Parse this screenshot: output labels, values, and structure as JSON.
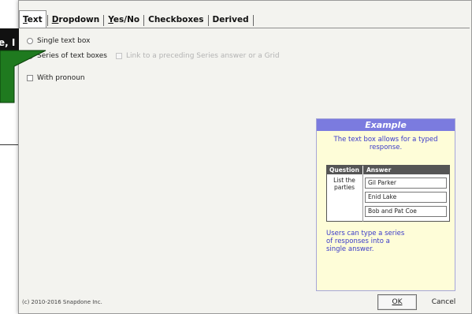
{
  "callout": {
    "text": "e, I"
  },
  "tabs": [
    {
      "label": "Text",
      "mnemonic": "T",
      "rest": "ext",
      "active": true
    },
    {
      "label": "Dropdown",
      "mnemonic": "D",
      "rest": "ropdown",
      "active": false
    },
    {
      "label": "Yes/No",
      "mnemonic": "Y",
      "rest": "es/No",
      "active": false
    },
    {
      "label": "Checkboxes",
      "mnemonic": "",
      "rest": "Checkboxes",
      "active": false
    },
    {
      "label": "Derived",
      "mnemonic": "",
      "rest": "Derived",
      "active": false
    }
  ],
  "options": {
    "single": {
      "label": "Single text box",
      "selected": false
    },
    "series": {
      "label": "Series of text boxes",
      "selected": true
    },
    "link": {
      "label": "Link to a preceding Series answer or a Grid",
      "checked": false,
      "disabled": true
    },
    "pronoun": {
      "label": "With pronoun",
      "checked": false
    }
  },
  "example": {
    "header": "Example",
    "intro": "The text box allows for a typed response.",
    "table": {
      "col_question": "Question",
      "col_answer": "Answer",
      "question": "List the parties",
      "answers": [
        "Gil Parker",
        "Enid Lake",
        "Bob and Pat Coe"
      ]
    },
    "note": "Users can type a series of responses into a single answer."
  },
  "footer": {
    "copyright": "(c) 2010-2016 Snapdone Inc.",
    "ok": "OK",
    "cancel": "Cancel"
  },
  "colors": {
    "example_header": "#7b7bdf",
    "example_bg": "#fefdd8",
    "example_text": "#3a3ac8",
    "callout_bubble": "#1f7a1f"
  }
}
